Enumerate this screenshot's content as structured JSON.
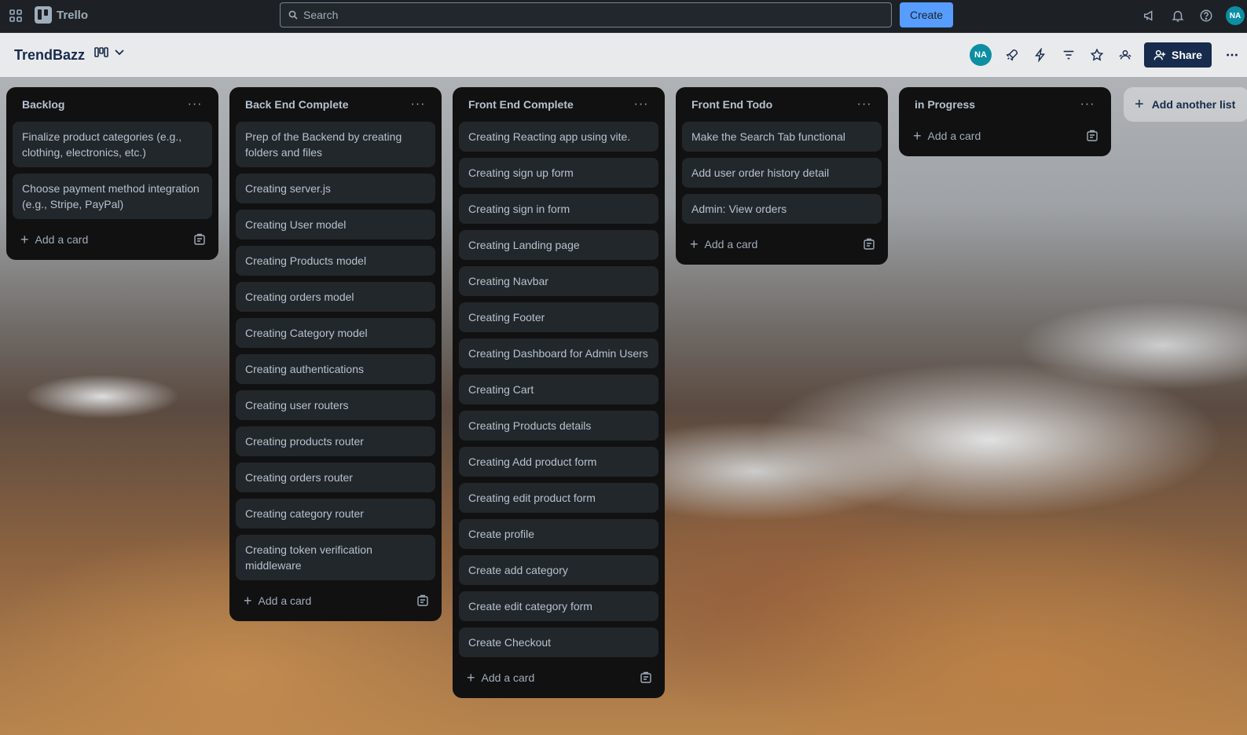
{
  "topbar": {
    "app_name": "Trello",
    "search_placeholder": "Search",
    "create_label": "Create",
    "user_initials": "NA"
  },
  "board": {
    "title": "TrendBazz",
    "member_initials": "NA",
    "share_label": "Share"
  },
  "lists": [
    {
      "title": "Backlog",
      "cards": [
        "Finalize product categories (e.g., clothing, electronics, etc.)",
        "Choose payment method integration (e.g., Stripe, PayPal)"
      ],
      "add_card_label": "Add a card"
    },
    {
      "title": "Back End Complete",
      "cards": [
        "Prep of the Backend by creating folders and files",
        "Creating server.js",
        "Creating User model",
        "Creating Products model",
        "Creating orders model",
        "Creating Category model",
        "Creating authentications",
        "Creating user routers",
        "Creating products router",
        "Creating orders router",
        "Creating category router",
        "Creating token verification middleware"
      ],
      "add_card_label": "Add a card"
    },
    {
      "title": "Front End Complete",
      "cards": [
        "Creating Reacting app using vite.",
        "Creating sign up form",
        "Creating sign in form",
        "Creating Landing page",
        "Creating Navbar",
        "Creating Footer",
        "Creating Dashboard for Admin Users",
        "Creating Cart",
        "Creating Products details",
        "Creating Add product form",
        "Creating edit product form",
        "Create profile",
        "Create add category",
        "Create edit category form",
        "Create Checkout"
      ],
      "add_card_label": "Add a card"
    },
    {
      "title": "Front End Todo",
      "cards": [
        "Make the Search Tab functional",
        "Add user order history detail",
        "Admin: View orders"
      ],
      "add_card_label": "Add a card"
    },
    {
      "title": "in Progress",
      "cards": [],
      "add_card_label": "Add a card"
    }
  ],
  "add_list_label": "Add another list",
  "icons": {
    "apps": "apps-grid-icon",
    "search": "search-icon",
    "notifications": "bell-icon",
    "help": "help-icon",
    "announcements": "megaphone-icon",
    "board_view": "board-view-icon",
    "power_ups": "rocket-icon",
    "automation": "lightning-icon",
    "filter": "filter-icon",
    "star": "star-icon",
    "visibility": "people-icon",
    "more": "more-icon",
    "template": "card-template-icon"
  },
  "colors": {
    "topbar_bg": "#1d2125",
    "create_button": "#579dff",
    "avatar": "#0c8ea3",
    "share_button": "#172b4d",
    "list_bg": "#111111",
    "card_bg": "#22272b"
  }
}
